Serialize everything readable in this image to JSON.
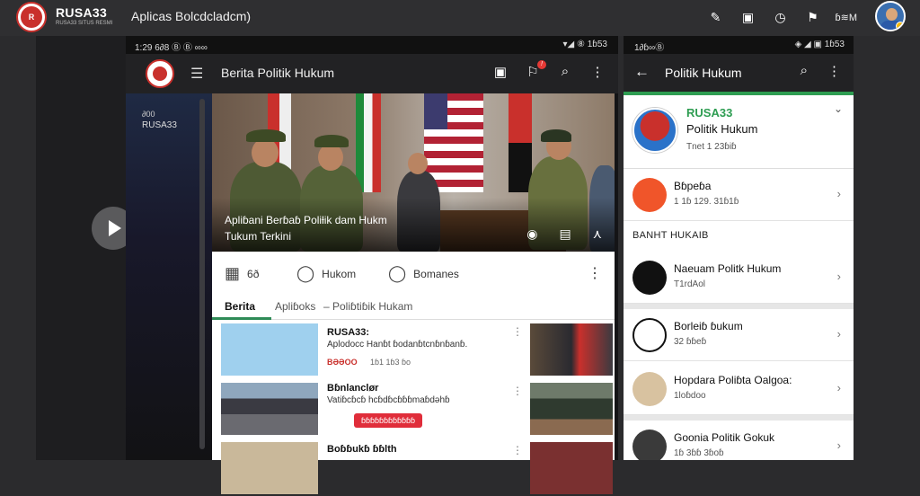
{
  "header": {
    "brand_name": "RUSA33",
    "brand_sub": "RUSA33 SITUS RESMI",
    "app_title": "Aplicas Bolcdcladcm)",
    "user_label": "ɓ≋M"
  },
  "phone1": {
    "status_left": "1:29 6∂8 Ⓑ Ⓑ ∞∞",
    "status_right": "▾◢ ⑧ 1ɓ53",
    "title": "Berita Politik Hukum",
    "sidebar_line1": "∂00",
    "sidebar_line2": "RUSA33",
    "hero_caption1": "Apliɓani Berɓaɓ Poliƚik dam Hukm",
    "hero_caption2": "Tukum Terkini",
    "actions": {
      "like_count": "6ð",
      "comment_label": "Hukom",
      "share_label": "Bomanes"
    },
    "tabs": [
      "Berita",
      "Apliɓoks",
      "– Poliɓtiɓik Hukam"
    ],
    "feed": [
      {
        "title": "RUSA33:",
        "subtitle": "Aplodocc Hanɓt ɓodanɓtcnɓnɓanɓ.",
        "meta": "BƏƏOO",
        "meta2": "1ɓ1 1ɓ3   ɓo"
      },
      {
        "title": "Bɓnlanclør",
        "subtitle": "Vatiɓcɓcɓ hcɓdɓcɓɓɓmaɓdəhɓ",
        "tag": "ɓɓɓɓɓɓɓɓɓɓɓɓ"
      },
      {
        "title": "Boɓɓukɓ ɓɓlth",
        "subtitle": ""
      }
    ]
  },
  "phone2": {
    "status_left": "1∂ɓ∞Ⓑ",
    "status_right": "◈ ◢ ▣ 1ɓ53",
    "title": "Politik Hukum",
    "profile": {
      "name": "RUSA33",
      "line2": "Politik Hukum",
      "line3": "Tnet 1 23ɓiɓ"
    },
    "item1": {
      "title": "Bɓpeɓa",
      "sub": "1 1ɓ 129. 31ɓ1ɓ"
    },
    "section_label": "BANHT HUKAIB",
    "items": [
      {
        "title": "Naeuam Politk Hukum",
        "sub": "T1rdAol"
      },
      {
        "title": "Borleiɓ ɓukum",
        "sub": "32 ɓɓeɓ"
      },
      {
        "title": "Hopdara Poliɓta Oalgoa:",
        "sub": "1loɓdoo"
      },
      {
        "title": "Goonia Politik Gokuk",
        "sub": "1ɓ 3ɓɓ 3ɓoɓ"
      }
    ]
  },
  "colors": {
    "accent_green": "#2e9d52",
    "brand_red": "#c9302c",
    "tag_red": "#e02d3a"
  }
}
